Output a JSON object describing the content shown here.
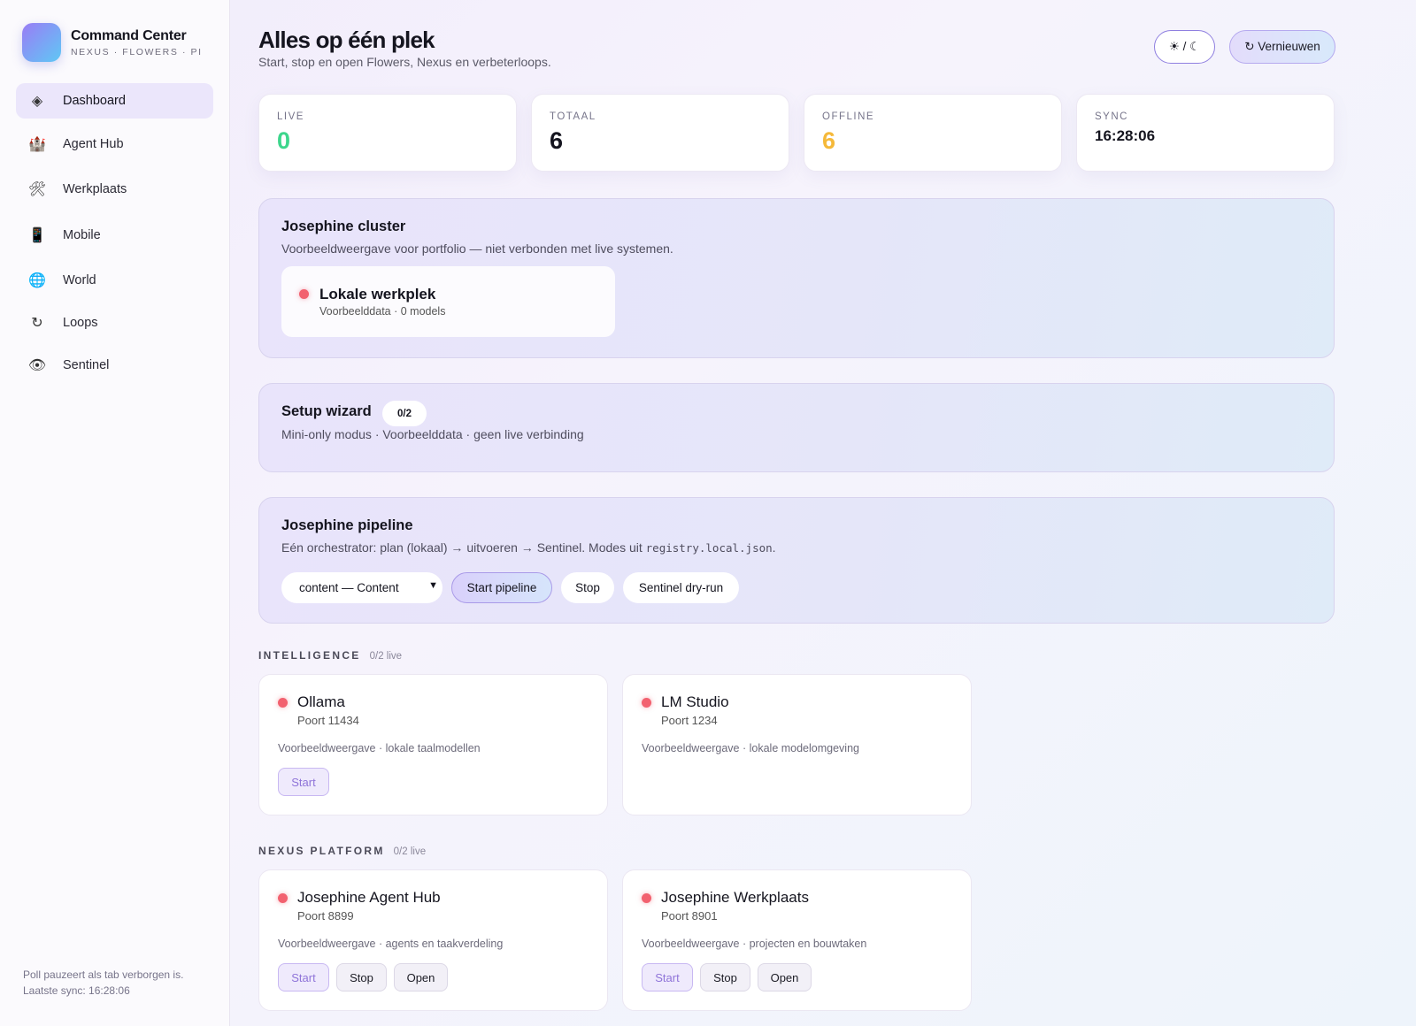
{
  "brand": {
    "title": "Command Center",
    "subtitle": "NEXUS · FLOWERS · PI"
  },
  "sidebar": {
    "items": [
      {
        "label": "Dashboard",
        "icon": "◈",
        "icon_name": "diamond-icon",
        "active": true
      },
      {
        "label": "Agent Hub",
        "icon": "🏰",
        "icon_name": "castle-icon",
        "active": false
      },
      {
        "label": "Werkplaats",
        "icon": "🛠",
        "icon_name": "tools-icon",
        "active": false
      },
      {
        "label": "Mobile",
        "icon": "📱",
        "icon_name": "phone-icon",
        "active": false
      },
      {
        "label": "World",
        "icon": "🌐",
        "icon_name": "globe-icon",
        "active": false
      },
      {
        "label": "Loops",
        "icon": "↻",
        "icon_name": "refresh-icon",
        "active": false
      },
      {
        "label": "Sentinel",
        "icon": "👁",
        "icon_name": "eye-icon",
        "active": false
      }
    ],
    "footer_line1": "Poll pauzeert als tab verborgen is.",
    "footer_line2": "Laatste sync: 16:28:06"
  },
  "header": {
    "title": "Alles op één plek",
    "subtitle": "Start, stop en open Flowers, Nexus en verbeterloops.",
    "theme_toggle": "☀ / ☾",
    "refresh_label": "↻ Vernieuwen"
  },
  "stats": [
    {
      "label": "LIVE",
      "value": "0",
      "color": "#3dd68c"
    },
    {
      "label": "TOTAAL",
      "value": "6",
      "color": "#15151f"
    },
    {
      "label": "OFFLINE",
      "value": "6",
      "color": "#f5b93a"
    },
    {
      "label": "SYNC",
      "value": "16:28:06",
      "color": "#15151f"
    }
  ],
  "cluster": {
    "title": "Josephine cluster",
    "description": "Voorbeeldweergave voor portfolio — niet verbonden met live systemen.",
    "node_title": "Lokale werkplek",
    "node_sub": "Voorbeelddata · 0 models"
  },
  "wizard": {
    "title": "Setup wizard",
    "badge": "0/2",
    "description": "Mini-only modus · Voorbeelddata · geen live verbinding"
  },
  "pipeline": {
    "title": "Josephine pipeline",
    "description_prefix": "Eén orchestrator: plan (lokaal) → uitvoeren → Sentinel. Modes uit ",
    "description_code": "registry.local.json",
    "description_suffix": ".",
    "select_value": "content — Content",
    "start_label": "Start pipeline",
    "stop_label": "Stop",
    "dry_run_label": "Sentinel dry-run"
  },
  "sections": [
    {
      "label": "INTELLIGENCE",
      "count": "0/2 live",
      "services": [
        {
          "title": "Ollama",
          "port": "Poort 11434",
          "desc": "Voorbeeldweergave · lokale taalmodellen",
          "start": "Start"
        },
        {
          "title": "LM Studio",
          "port": "Poort 1234",
          "desc": "Voorbeeldweergave · lokale modelomgeving"
        }
      ]
    },
    {
      "label": "NEXUS PLATFORM",
      "count": "0/2 live",
      "services": [
        {
          "title": "Josephine Agent Hub",
          "port": "Poort 8899",
          "desc": "Voorbeeldweergave · agents en taakverdeling",
          "start": "Start",
          "stop": "Stop",
          "open": "Open"
        },
        {
          "title": "Josephine Werkplaats",
          "port": "Poort 8901",
          "desc": "Voorbeeldweergave · projecten en bouwtaken",
          "start": "Start",
          "stop": "Stop",
          "open": "Open"
        }
      ]
    }
  ],
  "colors": {
    "accent": "#9a7cf5",
    "offline_dot": "#f2616f",
    "live": "#3dd68c",
    "warning": "#f5b93a"
  }
}
